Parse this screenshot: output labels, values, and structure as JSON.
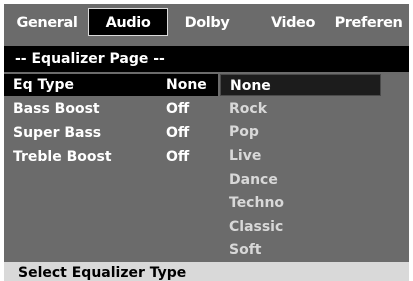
{
  "tabs": [
    {
      "label": "General"
    },
    {
      "label": "Audio"
    },
    {
      "label": "Dolby"
    },
    {
      "label": "Video"
    },
    {
      "label": "Preferen"
    }
  ],
  "page_title": "-- Equalizer Page --",
  "settings": [
    {
      "label": "Eq Type",
      "value": "None"
    },
    {
      "label": "Bass Boost",
      "value": "Off"
    },
    {
      "label": "Super Bass",
      "value": "Off"
    },
    {
      "label": "Treble Boost",
      "value": "Off"
    }
  ],
  "options": [
    "None",
    "Rock",
    "Pop",
    "Live",
    "Dance",
    "Techno",
    "Classic",
    "Soft"
  ],
  "status_text": "Select Equalizer Type"
}
